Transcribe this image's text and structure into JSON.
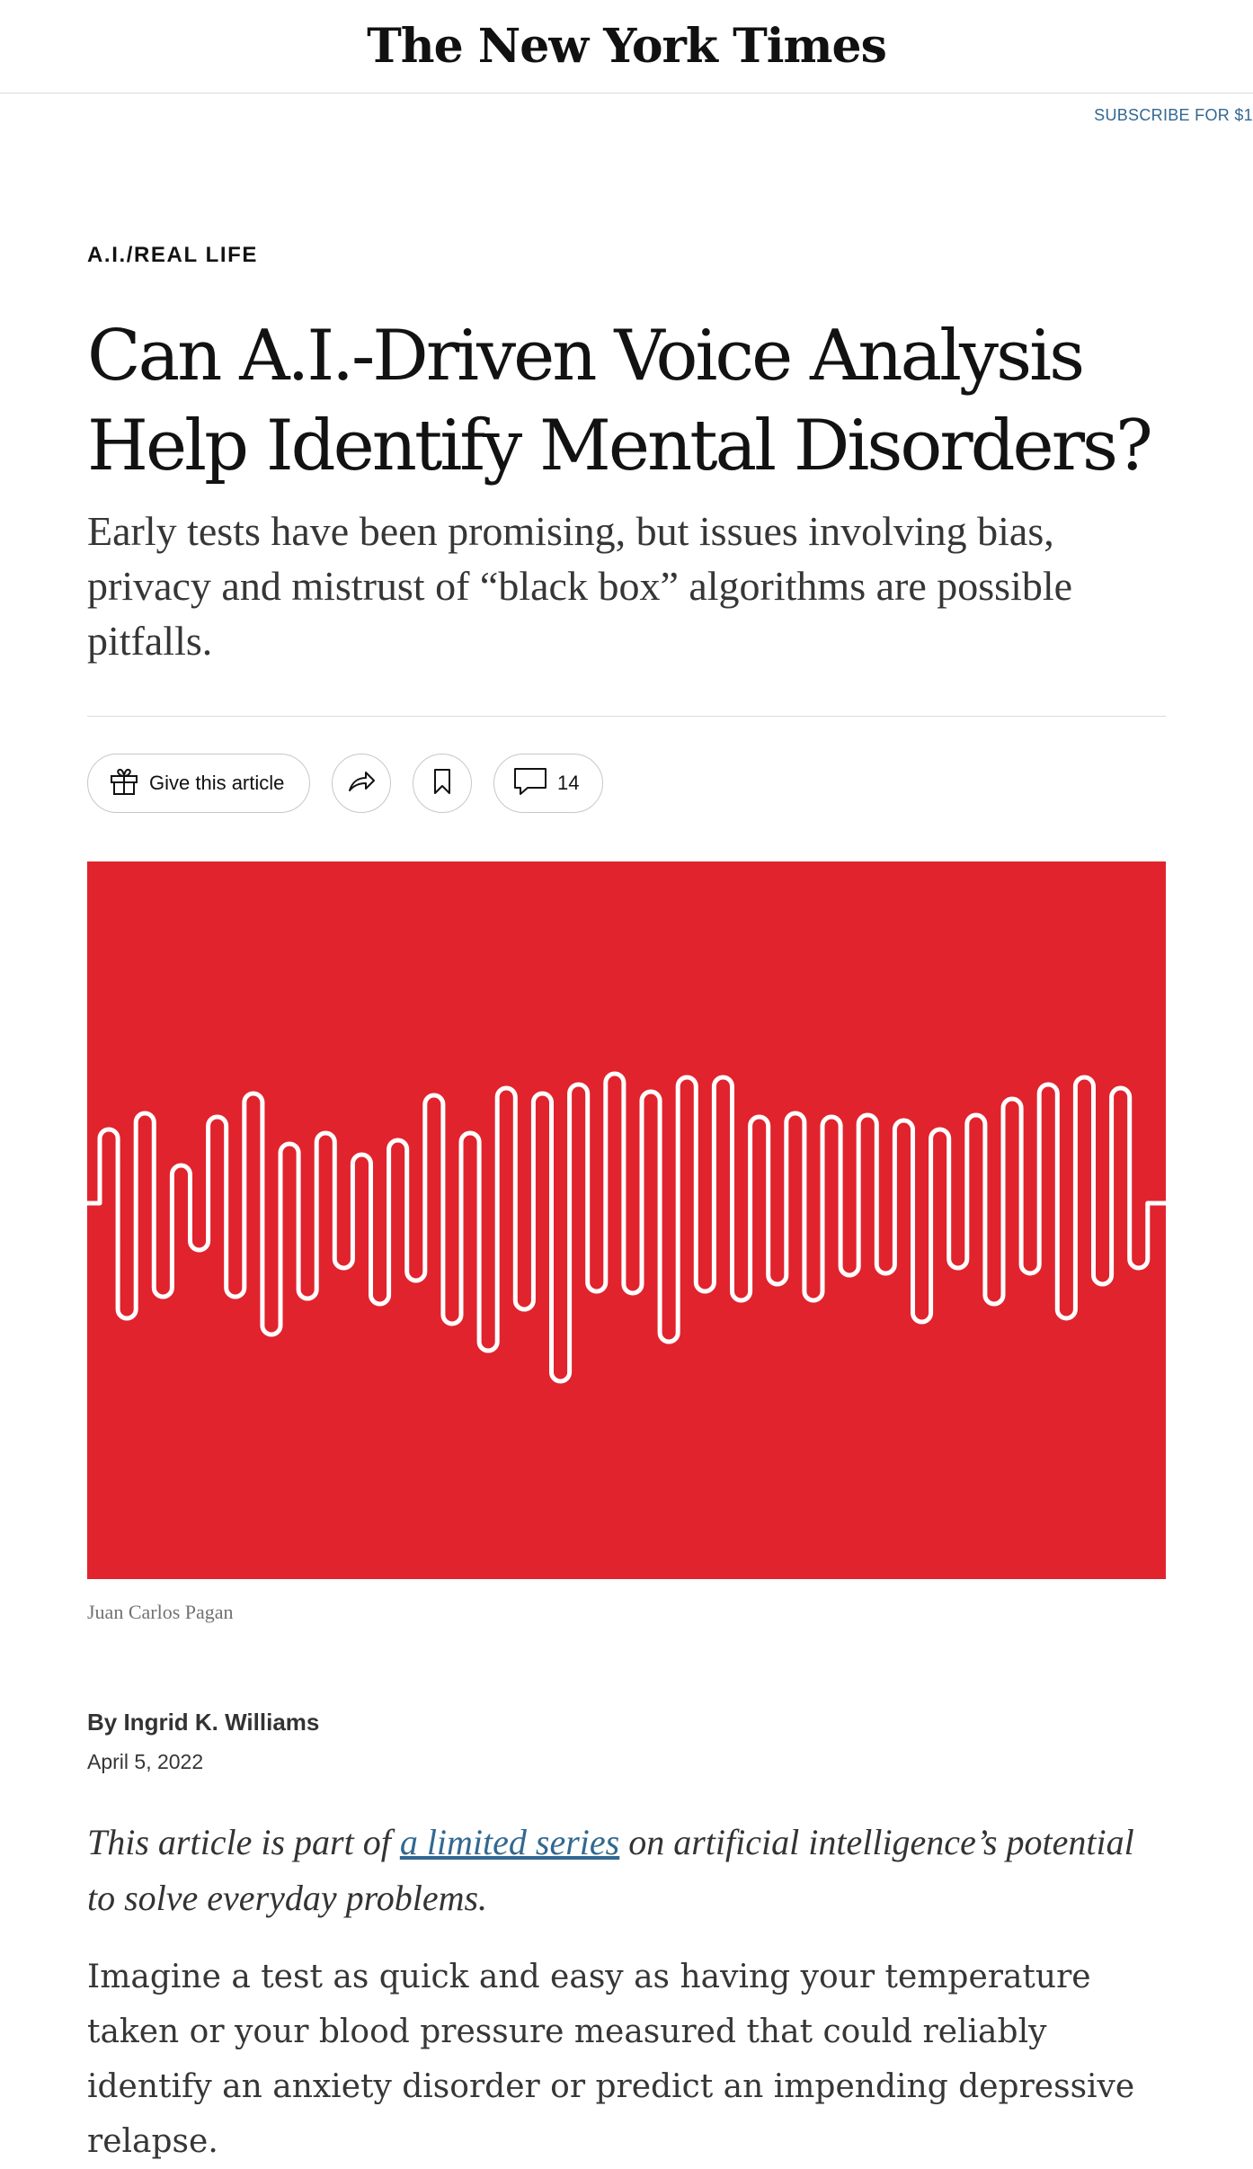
{
  "masthead": {
    "logo": "The New York Times",
    "subscribe": "SUBSCRIBE FOR $1"
  },
  "article": {
    "kicker": "A.I./REAL LIFE",
    "headline": "Can A.I.-Driven Voice Analysis Help Identify Mental Disorders?",
    "summary": "Early tests have been promising, but issues involving bias, privacy and mistrust of “black box” algorithms are possible pitfalls.",
    "toolbar": {
      "gift_label": "Give this article",
      "share_icon": "share-icon",
      "save_icon": "bookmark-icon",
      "comment_count": "14"
    },
    "image": {
      "background_color": "#e0232d",
      "credit": "Juan Carlos Pagan"
    },
    "byline": "By Ingrid K. Williams",
    "date": "April 5, 2022",
    "series_note": {
      "before": "This article is part of ",
      "link": "a limited series",
      "after": " on artificial intelligence’s potential to solve everyday problems."
    },
    "first_paragraph": "Imagine a test as quick and easy as having your temperature taken or your blood pressure measured that could reliably identify an anxiety disorder or predict an impending depressive relapse."
  }
}
